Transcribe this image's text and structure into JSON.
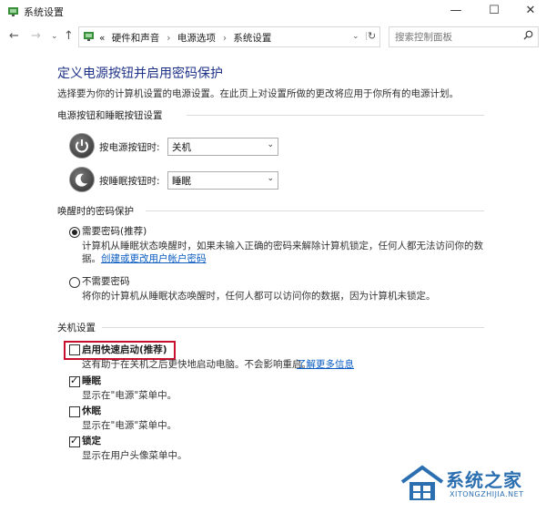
{
  "window": {
    "title": "系统设置"
  },
  "nav": {
    "breadcrumb_prefix": "«",
    "breadcrumbs": [
      "硬件和声音",
      "电源选项",
      "系统设置"
    ],
    "search_placeholder": "搜索控制面板"
  },
  "page": {
    "title": "定义电源按钮并启用密码保护",
    "description": "选择要为你的计算机设置的电源设置。在此页上对设置所做的更改将应用于你所有的电源计划。"
  },
  "buttons_section": {
    "header": "电源按钮和睡眠按钮设置",
    "power_button_label": "按电源按钮时:",
    "power_button_value": "关机",
    "sleep_button_label": "按睡眠按钮时:",
    "sleep_button_value": "睡眠"
  },
  "wake_section": {
    "header": "唤醒时的密码保护",
    "require_label": "需要密码(推荐)",
    "require_desc": "计算机从睡眠状态唤醒时，如果未输入正确的密码来解除计算机锁定，任何人都无法访问你的数",
    "require_desc2": "据。",
    "require_link": "创建或更改用户帐户密码",
    "norequire_label": "不需要密码",
    "norequire_desc": "将你的计算机从睡眠状态唤醒时，任何人都可以访问你的数据，因为计算机未锁定。"
  },
  "shutdown_section": {
    "header": "关机设置",
    "fast_startup_label": "启用快速启动(推荐)",
    "fast_startup_desc": "这有助于在关机之后更快地启动电脑。不会影响重启。",
    "fast_startup_link": "了解更多信息",
    "sleep_label": "睡眠",
    "sleep_desc": "显示在\"电源\"菜单中。",
    "hibernate_label": "休眠",
    "hibernate_desc": "显示在\"电源\"菜单中。",
    "lock_label": "锁定",
    "lock_desc": "显示在用户头像菜单中。"
  },
  "watermark": {
    "text": "系统之家",
    "url": "XITONGZHIJIA.NET"
  },
  "colors": {
    "title_blue": "#1e3287",
    "link_blue": "#0a5cc2",
    "highlight_red": "#c8102e"
  }
}
